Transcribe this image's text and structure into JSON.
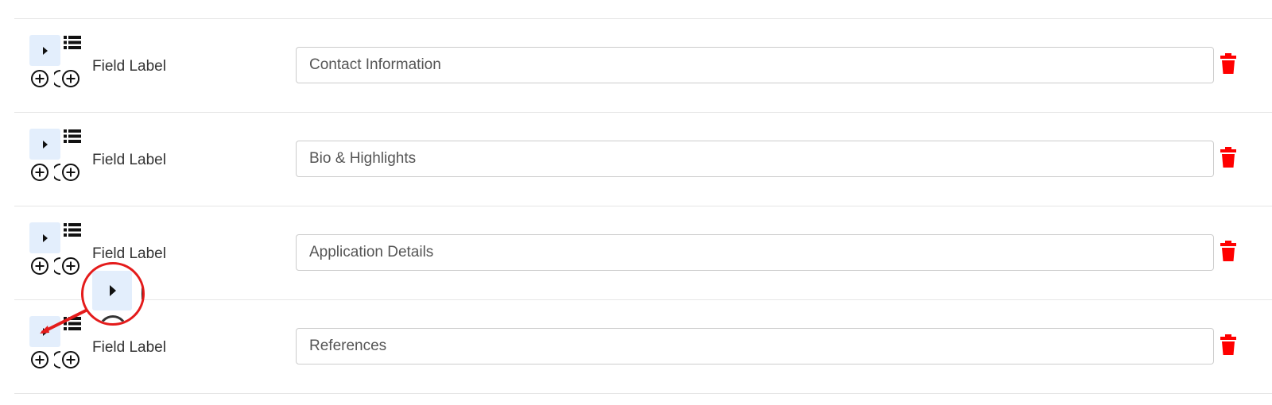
{
  "fields": [
    {
      "label": "Field Label",
      "value": "Contact Information"
    },
    {
      "label": "Field Label",
      "value": "Bio & Highlights"
    },
    {
      "label": "Field Label",
      "value": "Application Details"
    },
    {
      "label": "Field Label",
      "value": "References"
    }
  ],
  "icons": {
    "expand": "caret-right-icon",
    "reorder": "list-icon",
    "add": "plus-circle-icon",
    "add_child": "plus-circle-nested-icon",
    "delete": "trash-icon"
  },
  "colors": {
    "delete": "#ff0000",
    "annotation": "#e41b1b",
    "expand_button_bg": "#e3eefc"
  }
}
